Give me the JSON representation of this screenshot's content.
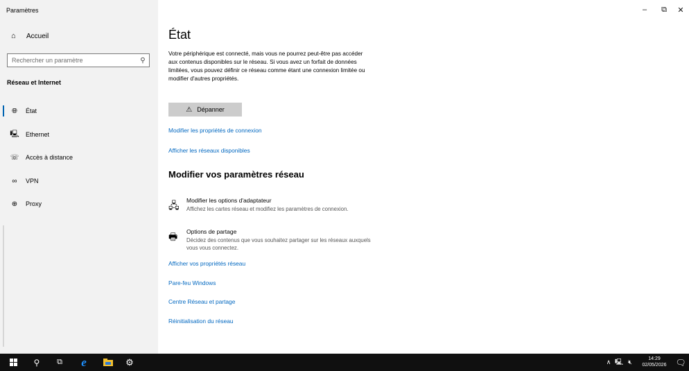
{
  "window": {
    "title": "Paramètres",
    "minimize": "–",
    "maximize": "⧉",
    "close": "✕"
  },
  "sidebar": {
    "home_label": "Accueil",
    "search_placeholder": "Rechercher un paramètre",
    "section_heading": "Réseau et Internet",
    "items": [
      {
        "label": "État",
        "icon": "globe-icon",
        "active": true
      },
      {
        "label": "Ethernet",
        "icon": "ethernet-icon"
      },
      {
        "label": "Accès à distance",
        "icon": "dialup-icon"
      },
      {
        "label": "VPN",
        "icon": "vpn-icon"
      },
      {
        "label": "Proxy",
        "icon": "globe-icon"
      }
    ]
  },
  "main": {
    "title": "État",
    "description": "Votre périphérique est connecté, mais vous ne pourrez peut-être pas accéder aux contenus disponibles sur le réseau. Si vous avez un forfait de données limitées, vous pouvez définir ce réseau comme étant une connexion limitée ou modifier d'autres propriétés.",
    "troubleshoot_label": "Dépanner",
    "link_properties": "Modifier les propriétés de connexion",
    "link_networks": "Afficher les réseaux disponibles",
    "subheading": "Modifier vos paramètres réseau",
    "options": [
      {
        "title": "Modifier les options d'adaptateur",
        "desc": "Affichez les cartes réseau et modifiez les paramètres de connexion.",
        "icon": "adapter-icon"
      },
      {
        "title": "Options de partage",
        "desc": "Décidez des contenus que vous souhaitez partager sur les réseaux auxquels vous vous connectez.",
        "icon": "sharing-icon"
      }
    ],
    "links_bottom": [
      "Afficher vos propriétés réseau",
      "Pare-feu Windows",
      "Centre Réseau et partage",
      "Réinitialisation du réseau"
    ]
  },
  "taskbar": {
    "time": "14:29",
    "date": "02/05/2026",
    "accent": "#0078d7"
  },
  "colors": {
    "link": "#0067c0",
    "sidebar_bg": "#f2f2f2",
    "active_bar": "#0063b1",
    "taskbar_bg": "#101010"
  }
}
